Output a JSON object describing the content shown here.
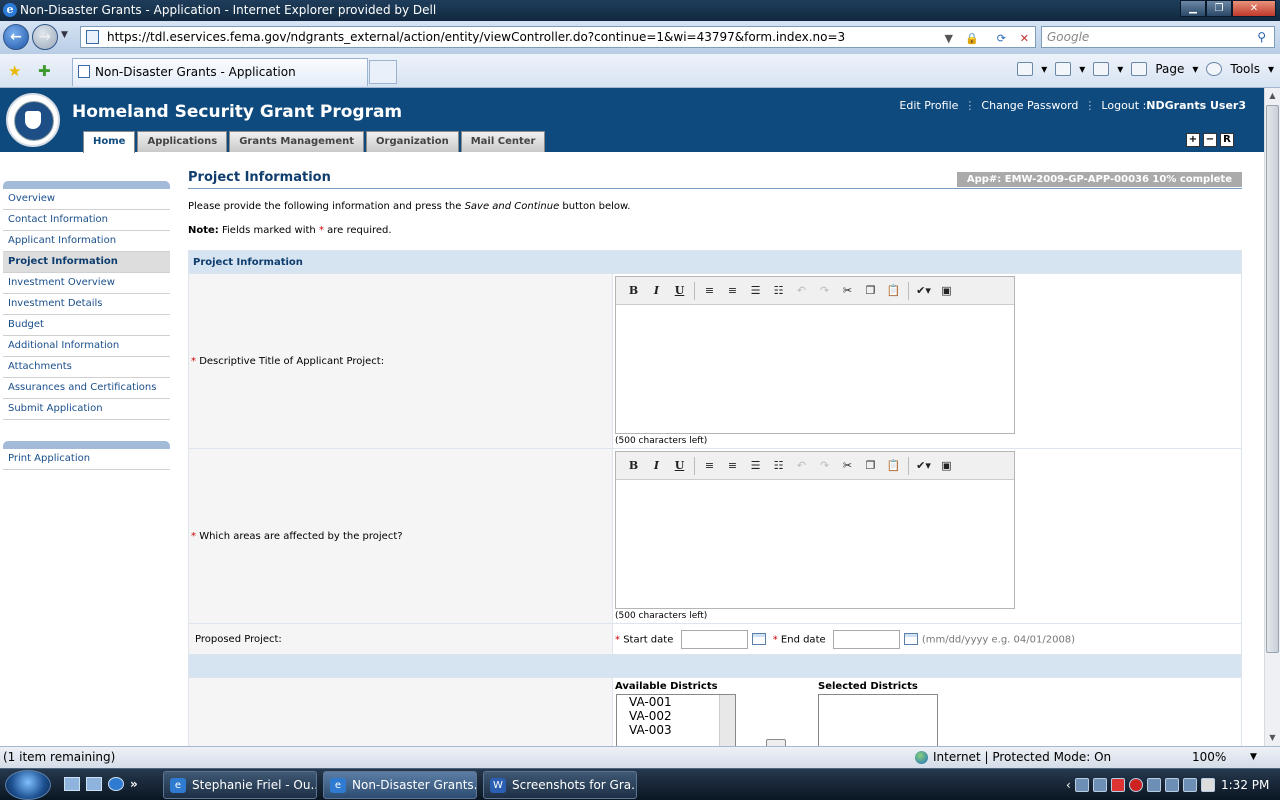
{
  "window": {
    "title": "Non-Disaster Grants - Application - Internet Explorer provided by Dell"
  },
  "browser": {
    "url": "https://tdl.eservices.fema.gov/ndgrants_external/action/entity/viewController.do?continue=1&wi=43797&form.index.no=3",
    "search_placeholder": "Google",
    "tab_title": "Non-Disaster Grants - Application",
    "commands": {
      "page": "Page",
      "tools": "Tools"
    }
  },
  "app": {
    "title": "Homeland Security Grant Program",
    "user_nav": {
      "edit_profile": "Edit Profile",
      "change_password": "Change Password",
      "logout": "Logout :",
      "username": "NDGrants User3"
    },
    "tabs": [
      "Home",
      "Applications",
      "Grants Management",
      "Organization",
      "Mail Center"
    ],
    "window_controls": [
      "+",
      "−",
      "R"
    ]
  },
  "sidebar": {
    "items": [
      "Overview",
      "Contact Information",
      "Applicant Information",
      "Project Information",
      "Investment Overview",
      "Investment Details",
      "Budget",
      "Additional Information",
      "Attachments",
      "Assurances and Certifications",
      "Submit Application"
    ],
    "active": "Project Information",
    "print": "Print Application"
  },
  "page": {
    "title": "Project Information",
    "app_number": "App#: EMW-2009-GP-APP-00036 10% complete",
    "intro_pre": "Please provide the following information and press the ",
    "intro_em": "Save and Continue",
    "intro_post": " button below.",
    "note_label": "Note:",
    "note_pre": " Fields marked with ",
    "note_star": "*",
    "note_post": " are required.",
    "section_header": "Project Information",
    "fields": {
      "title_label": "Descriptive Title of Applicant Project:",
      "title_counter": "(500 characters left)",
      "areas_label": "Which areas are affected by the project?",
      "areas_counter": "(500 characters left)",
      "proposed_label": "Proposed Project:",
      "start_label": "Start date",
      "end_label": "End date",
      "date_hint": "(mm/dd/yyyy e.g. 04/01/2008)",
      "available_districts": "Available Districts",
      "selected_districts": "Selected Districts",
      "districts": [
        "VA-001",
        "VA-002",
        "VA-003"
      ]
    },
    "required_mark": "*"
  },
  "statusbar": {
    "left": "(1 item remaining)",
    "zone": "Internet | Protected Mode: On",
    "zoom": "100%"
  },
  "taskbar": {
    "items": [
      "Stephanie Friel - Ou...",
      "Non-Disaster Grants...",
      "Screenshots for Gra..."
    ],
    "clock": "1:32 PM"
  }
}
